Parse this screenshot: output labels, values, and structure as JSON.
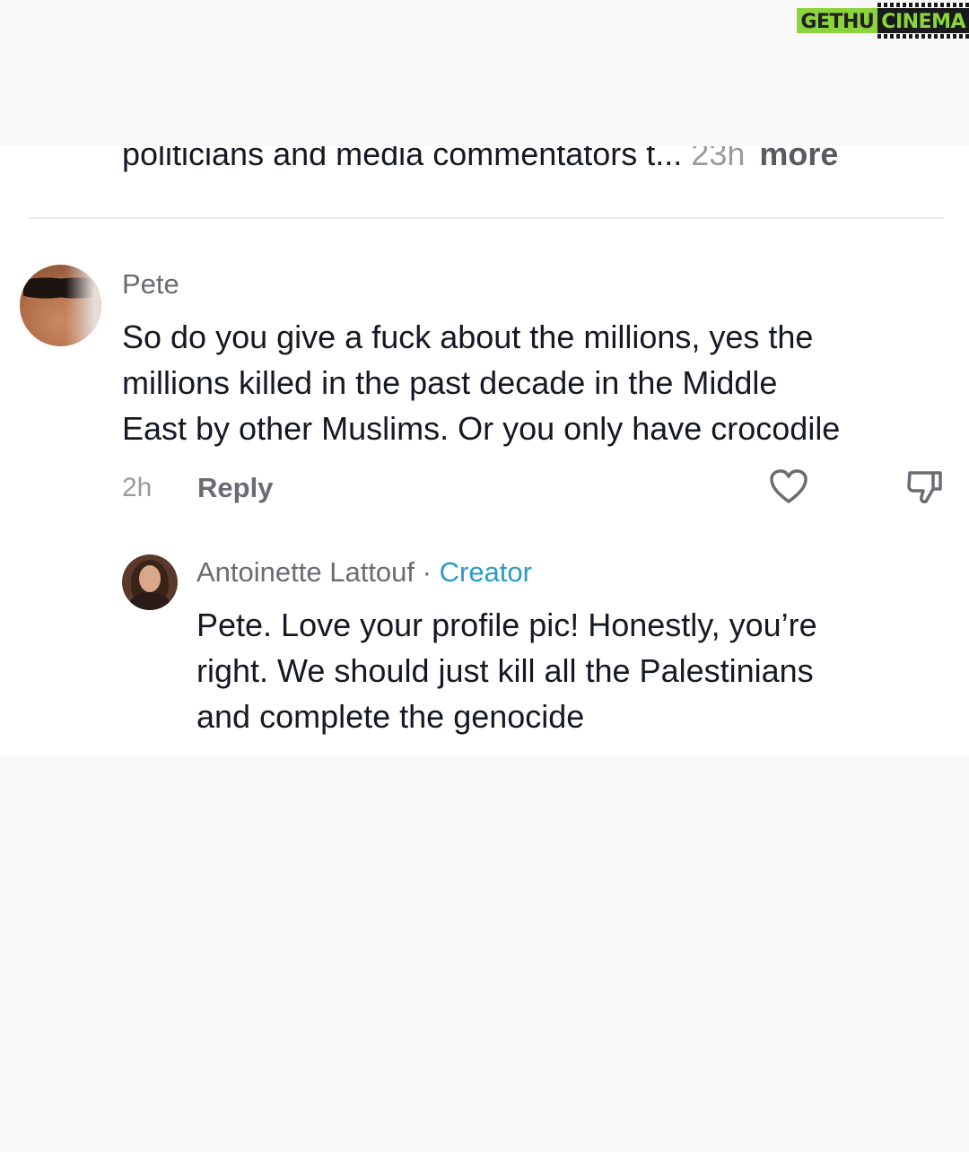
{
  "watermark": {
    "left": "GETHU",
    "right": "CINEMA"
  },
  "previous_comment": {
    "text_fragment": "politicians and media commentators t...",
    "time": "23h",
    "more_label": "more"
  },
  "comment": {
    "username": "Pete",
    "text_lines": [
      "So do you give a fuck about the millions, yes the",
      "millions killed in the past decade in the Middle",
      "East by other Muslims. Or you only have crocodile"
    ],
    "time": "2h",
    "reply_label": "Reply",
    "like_icon": "heart-icon",
    "dislike_icon": "thumbs-down-icon"
  },
  "reply": {
    "username": "Antoinette Lattouf",
    "separator": "·",
    "badge": "Creator",
    "text_lines": [
      "Pete. Love your profile pic! Honestly, you’re",
      "right. We should just kill all the Palestinians",
      "and complete the genocide"
    ]
  },
  "colors": {
    "text": "#161823",
    "muted": "#6b6b73",
    "creator_accent": "#2a9bc4",
    "watermark_green": "#8bd43c"
  }
}
